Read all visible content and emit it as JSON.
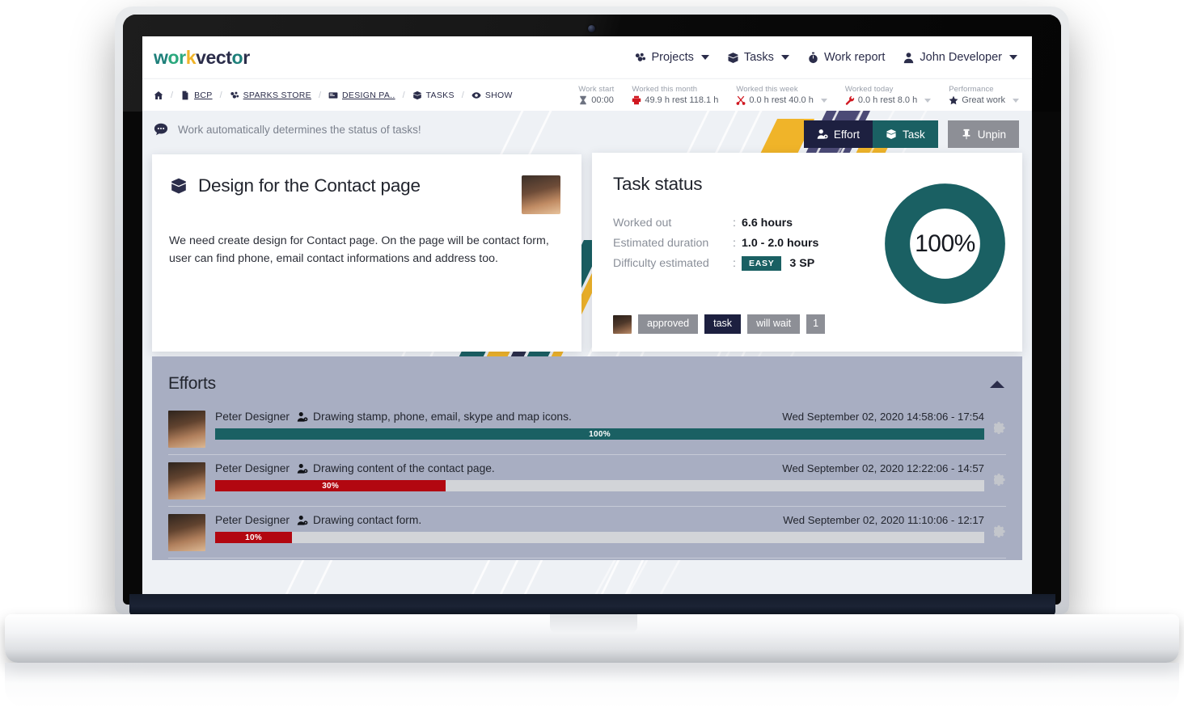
{
  "brand": {
    "logo_parts": [
      {
        "text": "w",
        "color": "#1e7f7a"
      },
      {
        "text": "or",
        "color": "#2aa87d"
      },
      {
        "text": "k",
        "color": "#f0b429"
      },
      {
        "text": "vect",
        "color": "#2b2d4a"
      },
      {
        "text": "o",
        "color": "#1e7f7a"
      },
      {
        "text": "r",
        "color": "#2b2d4a"
      }
    ]
  },
  "topnav": {
    "items": [
      {
        "label": "Projects",
        "icon": "projects-icon",
        "caret": true
      },
      {
        "label": "Tasks",
        "icon": "cube-icon",
        "caret": true
      },
      {
        "label": "Work report",
        "icon": "stopwatch-icon",
        "caret": false
      },
      {
        "label": "John Developer",
        "icon": "user-icon",
        "caret": true
      }
    ]
  },
  "breadcrumb": {
    "items": [
      {
        "label": "",
        "icon": "home-icon",
        "link": false
      },
      {
        "label": "BCP",
        "icon": "file-icon",
        "link": true
      },
      {
        "label": "SPARKS STORE",
        "icon": "cluster-icon",
        "link": true
      },
      {
        "label": "DESIGN PA..",
        "icon": "board-icon",
        "link": true
      },
      {
        "label": "TASKS",
        "icon": "cube-icon",
        "link": false
      },
      {
        "label": "SHOW",
        "icon": "eye-icon",
        "link": false
      }
    ],
    "separator": "/"
  },
  "stats": [
    {
      "label": "Work start",
      "value": "00:00",
      "icon": "hourglass-icon",
      "icon_color": "#6d7280",
      "caret": false
    },
    {
      "label": "Worked this month",
      "value": "49.9 h rest 118.1 h",
      "icon": "printer-icon",
      "icon_color": "#d0161f",
      "caret": false
    },
    {
      "label": "Worked this week",
      "value": "0.0 h rest 40.0 h",
      "icon": "scissors-icon",
      "icon_color": "#d0161f",
      "caret": true
    },
    {
      "label": "Worked today",
      "value": "0.0 h rest 8.0 h",
      "icon": "wrench-icon",
      "icon_color": "#d0161f",
      "caret": true
    },
    {
      "label": "Performance",
      "value": "Great work",
      "icon": "star-icon",
      "icon_color": "#2b2d4a",
      "caret": true
    }
  ],
  "notice": {
    "icon": "comment-icon",
    "text": "Work automatically determines the status of tasks!"
  },
  "actions": [
    {
      "label": "Effort",
      "icon": "user-gear-icon",
      "style": "btn-effort",
      "color": "#1d2040"
    },
    {
      "label": "Task",
      "icon": "cube-icon",
      "style": "btn-task",
      "color": "#1a6063"
    },
    {
      "label": "Unpin",
      "icon": "pin-icon",
      "style": "btn-unpin",
      "color": "#8d8f96"
    }
  ],
  "task_card": {
    "icon": "cube-icon",
    "title": "Design for the Contact page",
    "description": "We need create design for Contact page. On the page will be contact form, user can find phone, email contact informations and address too.",
    "avatar": "user-photo"
  },
  "status_card": {
    "title": "Task status",
    "rows": [
      {
        "label": "Worked out",
        "colon": ":",
        "value": "6.6 hours",
        "badge": null
      },
      {
        "label": "Estimated duration",
        "colon": ":",
        "value": "1.0 - 2.0 hours",
        "badge": null
      },
      {
        "label": "Difficulty estimated",
        "colon": ":",
        "value": "3 SP",
        "badge": "EASY"
      }
    ],
    "progress": {
      "percent": 100,
      "label": "100%",
      "color": "#1a6063"
    },
    "tags": [
      {
        "label": "approved",
        "style": "gray"
      },
      {
        "label": "task",
        "style": "dark"
      },
      {
        "label": "will wait",
        "style": "gray"
      },
      {
        "label": "1",
        "style": "gray"
      }
    ]
  },
  "efforts": {
    "title": "Efforts",
    "collapse_icon": "caret-up-icon",
    "rows": [
      {
        "person": "Peter Designer",
        "task_icon": "person-gear-icon",
        "task": "Drawing stamp, phone, email, skype and map icons.",
        "date": "Wed September 02, 2020 14:58:06 - 17:54",
        "percent": 100,
        "percent_label": "100%",
        "bar_color": "#1a6063",
        "gear_icon": "gear-icon"
      },
      {
        "person": "Peter Designer",
        "task_icon": "person-gear-icon",
        "task": "Drawing content of the contact page.",
        "date": "Wed September 02, 2020 12:22:06 - 14:57",
        "percent": 30,
        "percent_label": "30%",
        "bar_color": "#b20710",
        "gear_icon": "gear-icon"
      },
      {
        "person": "Peter Designer",
        "task_icon": "person-gear-icon",
        "task": "Drawing contact form.",
        "date": "Wed September 02, 2020 11:10:06 - 12:17",
        "percent": 10,
        "percent_label": "10%",
        "bar_color": "#b20710",
        "gear_icon": "gear-icon"
      }
    ]
  },
  "colors": {
    "brand_navy": "#2b2d4a",
    "brand_teal": "#1a6063",
    "brand_yellow": "#f0b429",
    "brand_purple": "#4b4a76",
    "danger_red": "#b20710",
    "panel_gray": "#a8aec2",
    "page_bg": "#eef1f5"
  }
}
